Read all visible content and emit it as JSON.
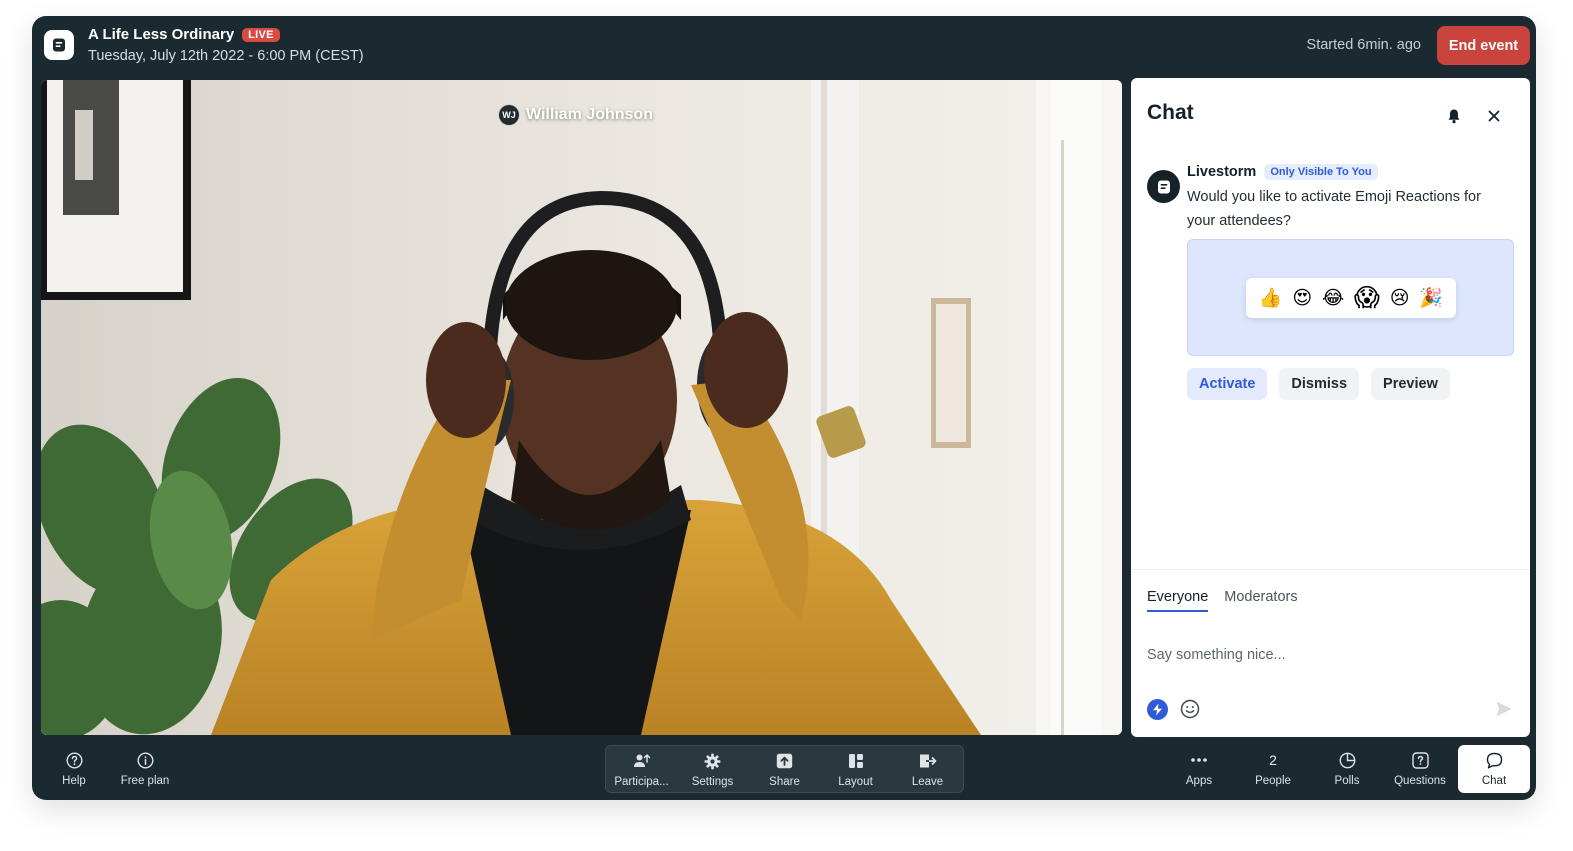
{
  "header": {
    "title": "A Life Less Ordinary",
    "live_badge": "LIVE",
    "date": "Tuesday, July 12th 2022 - 6:00 PM (CEST)",
    "started": "Started 6min. ago",
    "end_event": "End event"
  },
  "video": {
    "speaker_initials": "WJ",
    "speaker_name": "William Johnson"
  },
  "chat": {
    "title": "Chat",
    "message": {
      "author": "Livestorm",
      "badge": "Only Visible To You",
      "text": "Would you like to activate Emoji Reactions for your attendees?",
      "emojis": [
        "👍",
        "😍",
        "😂",
        "😱",
        "😢",
        "🎉"
      ]
    },
    "actions": {
      "activate": "Activate",
      "dismiss": "Dismiss",
      "preview": "Preview"
    },
    "tabs": [
      "Everyone",
      "Moderators"
    ],
    "input_placeholder": "Say something nice..."
  },
  "toolbar": {
    "left": [
      {
        "label": "Help",
        "icon": "help-circle-icon"
      },
      {
        "label": "Free plan",
        "icon": "info-circle-icon"
      }
    ],
    "center": [
      {
        "label": "Participa...",
        "icon": "participants-icon"
      },
      {
        "label": "Settings",
        "icon": "gear-icon"
      },
      {
        "label": "Share",
        "icon": "share-icon"
      },
      {
        "label": "Layout",
        "icon": "layout-icon"
      },
      {
        "label": "Leave",
        "icon": "leave-icon"
      }
    ],
    "right": [
      {
        "label": "Apps",
        "icon": "more-dots-icon"
      },
      {
        "label": "People",
        "count": "2"
      },
      {
        "label": "Polls",
        "icon": "poll-icon"
      },
      {
        "label": "Questions",
        "icon": "question-square-icon"
      },
      {
        "label": "Chat",
        "icon": "chat-bubble-icon"
      }
    ]
  },
  "colors": {
    "app_background": "#1b2a30",
    "live": "#d94a42",
    "end_event": "#c9443c",
    "accent": "#2f5bd6"
  }
}
